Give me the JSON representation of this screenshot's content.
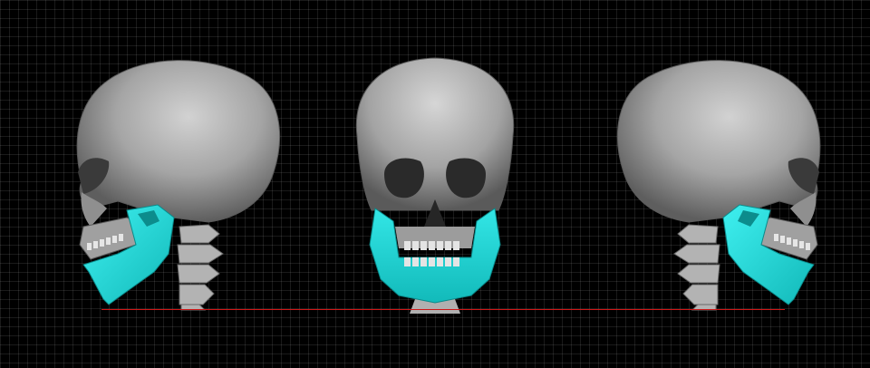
{
  "scene": {
    "background_color": "#000000",
    "grid_color": "#4a4a4a",
    "bone_color": "#a8a8a8",
    "mandible_color": "#19d6d6",
    "reference_line_color": "#d01818",
    "views": [
      {
        "name": "left-lateral"
      },
      {
        "name": "frontal"
      },
      {
        "name": "right-lateral"
      }
    ]
  }
}
